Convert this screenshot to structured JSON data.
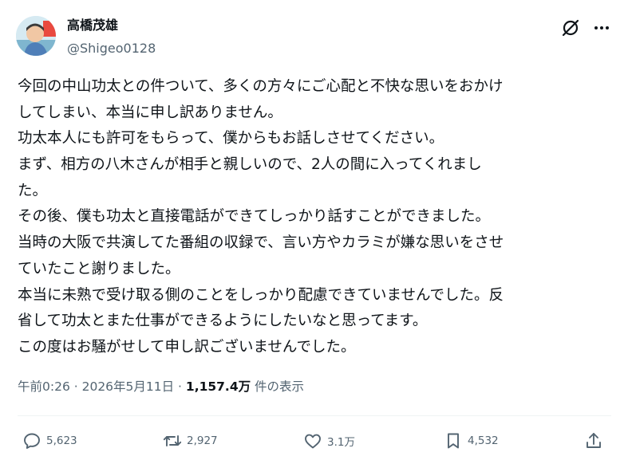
{
  "author": {
    "display_name": "高橋茂雄",
    "handle": "@Shigeo0128"
  },
  "post": {
    "lines": [
      "今回の中山功太との件ついて、多くの方々にご心配と不快な思いをおかけ",
      "してしまい、本当に申し訳ありません。",
      "功太本人にも許可をもらって、僕からもお話しさせてください。",
      "まず、相方の八木さんが相手と親しいので、2人の間に入ってくれまし",
      "た。",
      "その後、僕も功太と直接電話ができてしっかり話すことができました。",
      "当時の大阪で共演してた番組の収録で、言い方やカラミが嫌な思いをさせ",
      "ていたこと謝りました。",
      "本当に未熟で受け取る側のことをしっかり配慮できていませんでした。反",
      "省して功太とまた仕事ができるようにしたいなと思ってます。",
      "この度はお騒がせして申し訳ございませんでした。"
    ]
  },
  "meta": {
    "time": "午前0:26",
    "separator": " · ",
    "date": "2026年5月11日",
    "views_count": "1,157.4万",
    "views_label": " 件の表示"
  },
  "actions": {
    "reply_count": "5,623",
    "repost_count": "2,927",
    "like_count": "3.1万",
    "bookmark_count": "4,532"
  },
  "icons": {
    "grok": "grok-icon",
    "more": "more-icon",
    "reply": "reply-icon",
    "repost": "repost-icon",
    "like": "heart-icon",
    "bookmark": "bookmark-icon",
    "share": "share-icon"
  },
  "colors": {
    "text": "#0f1419",
    "secondary": "#536471",
    "divider": "#eff3f4"
  }
}
